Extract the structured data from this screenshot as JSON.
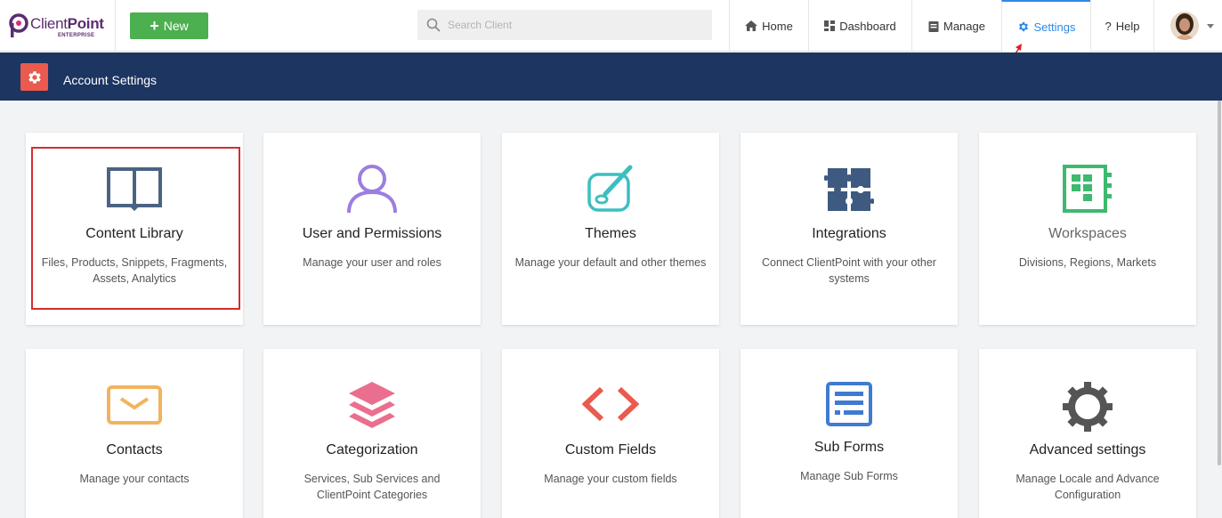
{
  "brand": {
    "name_light": "Client",
    "name_bold": "Point",
    "sub": "ENTERPRISE",
    "color": "#5b2c6f"
  },
  "toolbar": {
    "new_label": "New"
  },
  "search": {
    "placeholder": "Search Client"
  },
  "nav": {
    "home": "Home",
    "dashboard": "Dashboard",
    "manage": "Manage",
    "settings": "Settings",
    "help": "Help",
    "active": "settings",
    "active_color": "#2d8ae6"
  },
  "header": {
    "title": "Account Settings",
    "band_color": "#1c3561",
    "icon": "gear-icon"
  },
  "cards": [
    {
      "title": "Content Library",
      "desc": "Files, Products, Snippets, Fragments, Assets, Analytics",
      "icon": "book-icon",
      "color": "#4a6382",
      "highlighted": true
    },
    {
      "title": "User and Permissions",
      "desc": "Manage your user and roles",
      "icon": "user-icon",
      "color": "#9b7ee0"
    },
    {
      "title": "Themes",
      "desc": "Manage your default and other themes",
      "icon": "palette-brush-icon",
      "color": "#3bbfc0"
    },
    {
      "title": "Integrations",
      "desc": "Connect ClientPoint with your other systems",
      "icon": "puzzle-icon",
      "color": "#3e5a80"
    },
    {
      "title": "Workspaces",
      "desc": "Divisions, Regions, Markets",
      "icon": "workspace-grid-icon",
      "color": "#3cba6e"
    },
    {
      "title": "Contacts",
      "desc": "Manage your contacts",
      "icon": "envelope-icon",
      "color": "#f2b35e"
    },
    {
      "title": "Categorization",
      "desc": "Services, Sub Services and ClientPoint Categories",
      "icon": "layers-icon",
      "color": "#ea6f8e"
    },
    {
      "title": "Custom Fields",
      "desc": "Manage your custom fields",
      "icon": "code-brackets-icon",
      "color": "#ea5a4f"
    },
    {
      "title": "Sub Forms",
      "desc": "Manage Sub Forms",
      "icon": "form-icon",
      "color": "#3f7bd0"
    },
    {
      "title": "Advanced settings",
      "desc": "Manage Locale and Advance Configuration",
      "icon": "cog-icon",
      "color": "#555555"
    }
  ]
}
